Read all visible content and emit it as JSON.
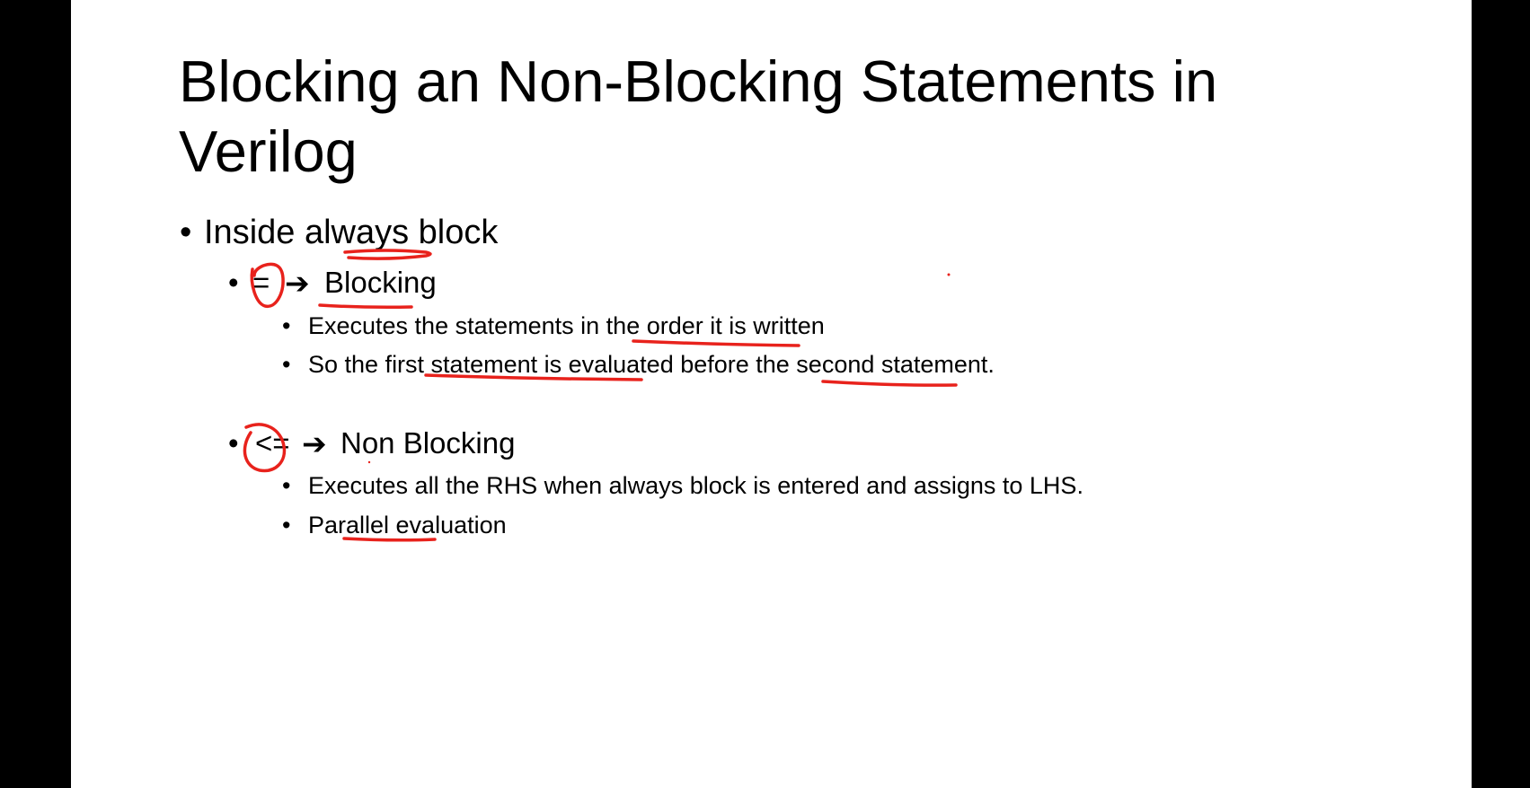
{
  "slide": {
    "title": "Blocking an Non-Blocking Statements in Verilog",
    "bullet_char": "•",
    "arrow_glyph": "➔",
    "level1": {
      "text": "Inside always block"
    },
    "blocking": {
      "operator": "=",
      "label": "Blocking",
      "subs": [
        "Executes the statements in the order it is written",
        "So the first statement is evaluated before the second statement."
      ]
    },
    "nonblocking": {
      "operator": "<=",
      "label": "Non Blocking",
      "subs": [
        "Executes all the RHS when always block is entered and assigns to LHS.",
        "Parallel evaluation"
      ]
    }
  },
  "colors": {
    "ink": "#e8221c",
    "text": "#000000",
    "background": "#ffffff",
    "frame": "#000000"
  }
}
